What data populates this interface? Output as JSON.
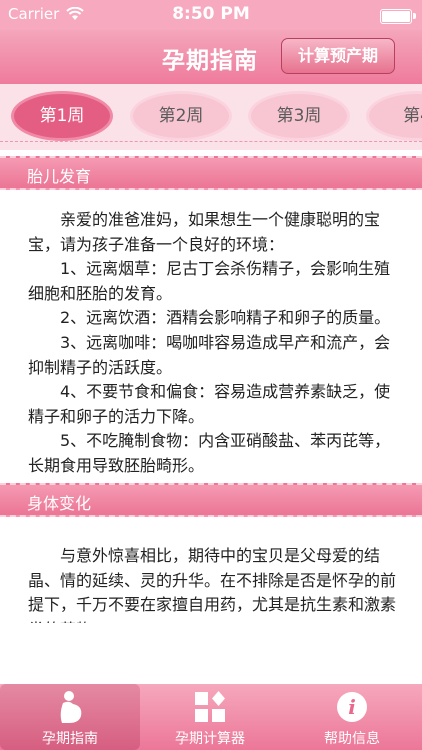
{
  "status_bar": {
    "carrier": "Carrier",
    "time": "8:50 PM"
  },
  "nav": {
    "title": "孕期指南",
    "right_button": "计算预产期"
  },
  "weeks": [
    "第1周",
    "第2周",
    "第3周",
    "第4"
  ],
  "selected_week": "第1周",
  "section1": {
    "title": "胎儿发育",
    "paragraphs": [
      "亲爱的准爸准妈，如果想生一个健康聪明的宝宝，请为孩子准备一个良好的环境：",
      "1、远离烟草：尼古丁会杀伤精子，会影响生殖细胞和胚胎的发育。",
      "2、远离饮酒：酒精会影响精子和卵子的质量。",
      "3、远离咖啡：喝咖啡容易造成早产和流产，会抑制精子的活跃度。",
      "4、不要节食和偏食：容易造成营养素缺乏，使精子和卵子的活力下降。",
      "5、不吃腌制食物：内含亚硝酸盐、苯丙芘等，长期食用导致胚胎畸形。"
    ]
  },
  "section2": {
    "title": "身体变化",
    "paragraphs": [
      "与意外惊喜相比，期待中的宝贝是父母爱的结晶、情的延续、灵的升华。在不排除是否是怀孕的前提下，千万不要在家擅自用药，尤其是抗生素和激素类的药物"
    ]
  },
  "tabbar": {
    "items": [
      {
        "label": "孕期指南",
        "icon": "pregnant-icon"
      },
      {
        "label": "孕期计算器",
        "icon": "calculator-icon"
      },
      {
        "label": "帮助信息",
        "icon": "info-icon"
      }
    ]
  },
  "colors": {
    "primary": "#ef7b9c",
    "active_week": "#e35e82",
    "section": "#eb7595"
  }
}
